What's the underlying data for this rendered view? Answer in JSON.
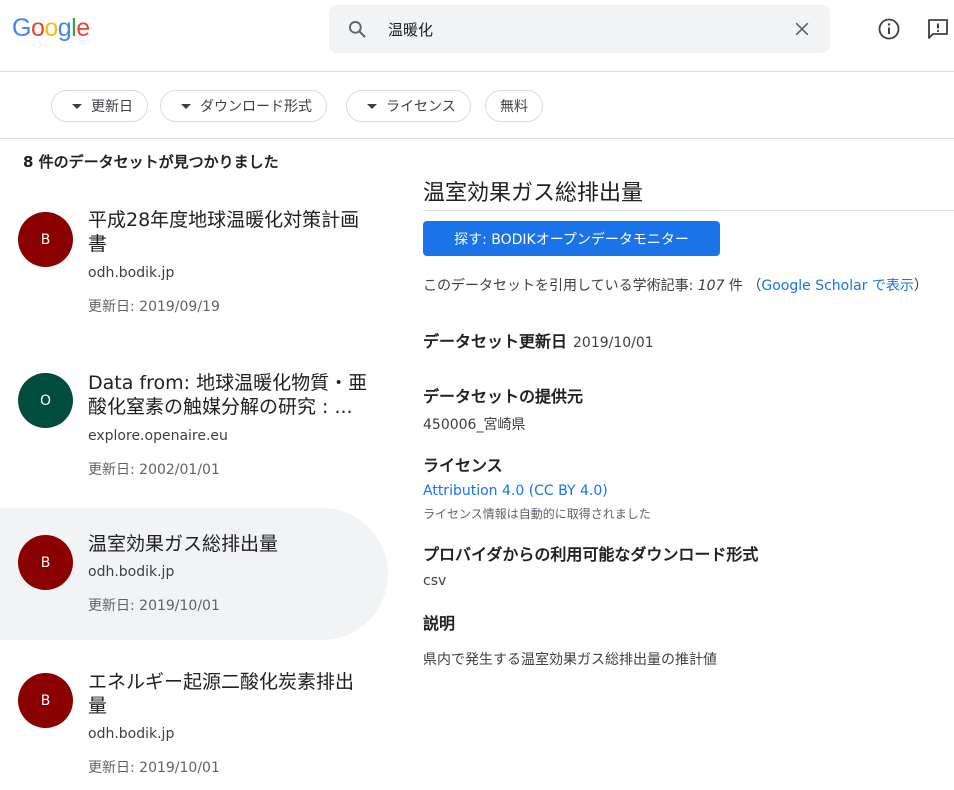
{
  "header": {
    "logo_letters": [
      "G",
      "o",
      "o",
      "g",
      "l",
      "e"
    ],
    "logo_colors": [
      "#4285f4",
      "#ea4335",
      "#fbbc05",
      "#4285f4",
      "#34a853",
      "#ea4335"
    ],
    "search_query": "温暖化"
  },
  "filters": [
    {
      "label": "更新日",
      "has_dropdown": true
    },
    {
      "label": "ダウンロード形式",
      "has_dropdown": true
    },
    {
      "label": "ライセンス",
      "has_dropdown": true
    },
    {
      "label": "無料",
      "has_dropdown": false
    }
  ],
  "results": {
    "count_text": "8 件のデータセットが見つかりました",
    "items": [
      {
        "avatar": "B",
        "avatar_color": "#8b0000",
        "title": "平成28年度地球温暖化対策計画書",
        "domain": "odh.bodik.jp",
        "updated": "更新日: 2019/09/19",
        "selected": false
      },
      {
        "avatar": "O",
        "avatar_color": "#004d40",
        "title": "Data from: 地球温暖化物質・亜酸化窒素の触媒分解の研究 : ...",
        "domain": "explore.openaire.eu",
        "updated": "更新日: 2002/01/01",
        "selected": false
      },
      {
        "avatar": "B",
        "avatar_color": "#8b0000",
        "title": "温室効果ガス総排出量",
        "domain": "odh.bodik.jp",
        "updated": "更新日: 2019/10/01",
        "selected": true
      },
      {
        "avatar": "B",
        "avatar_color": "#8b0000",
        "title": "エネルギー起源二酸化炭素排出量",
        "domain": "odh.bodik.jp",
        "updated": "更新日: 2019/10/01",
        "selected": false
      }
    ]
  },
  "detail": {
    "title": "温室効果ガス総排出量",
    "explore_button": "探す: BODIKオープンデータモニター",
    "citation_prefix": "このデータセットを引用している学術記事: ",
    "citation_count": "107",
    "citation_unit": " 件 （",
    "citation_link": "Google Scholar で表示",
    "citation_suffix": "）",
    "updated_label": "データセット更新日",
    "updated_value": "2019/10/01",
    "provider_label": "データセットの提供元",
    "provider_value": "450006_宮崎県",
    "license_label": "ライセンス",
    "license_value": "Attribution 4.0 (CC BY 4.0)",
    "license_note": "ライセンス情報は自動的に取得されました",
    "formats_label": "プロバイダからの利用可能なダウンロード形式",
    "formats_value": "csv",
    "description_label": "説明",
    "description_value": "県内で発生する温室効果ガス総排出量の推計値"
  }
}
